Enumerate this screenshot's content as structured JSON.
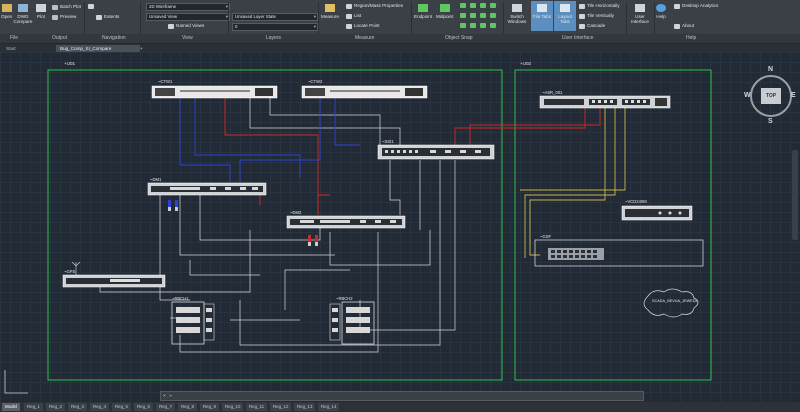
{
  "ribbon": {
    "open_label": "Open",
    "dwg_compare_label": "DWG Compare",
    "plot_label": "Plot",
    "batch_plot_label": "Batch Plot",
    "preview_label": "Preview",
    "extents_label": "Extents",
    "view_style_value": "2D Wireframe",
    "unsaved_view_value": "Unsaved View",
    "named_views_label": "Named Views",
    "layer_state_value": "Unsaved Layer State",
    "layer_value": "0",
    "measure_label": "Measure",
    "region_props_label": "Region/Mass Properties",
    "list_label": "List",
    "locate_point_label": "Locate Point",
    "endpoint_label": "Endpoint",
    "midpoint_label": "Midpoint",
    "switch_windows_label": "Switch Windows",
    "file_tabs_label": "File Tabs",
    "layout_tabs_label": "Layout Tabs",
    "tile_horiz_label": "Tile Horizontally",
    "tile_vert_label": "Tile Vertically",
    "cascade_label": "Cascade",
    "user_interface_label": "User Interface",
    "help_label": "Help",
    "desktop_analytics_label": "Desktop Analytics",
    "about_label": "About"
  },
  "panels": {
    "file": "File",
    "output": "Output",
    "navigation": "Navigation",
    "view": "View",
    "layers": "Layers",
    "measure": "Measure",
    "object_snap": "Object Snap",
    "user_interface": "User Interface",
    "help": "Help"
  },
  "doc_tabs": {
    "start": "Start",
    "file": "Bug_Comp_SI_Compare"
  },
  "drawing": {
    "frame1_label": "+U01",
    "frame2_label": "+U02",
    "dev_ctw1": "~CTW1",
    "dev_ctw2": "~CTW2",
    "dev_ssi1": "~SSI1",
    "dev_dm1": "~DM1",
    "dev_dm2": "~DM2",
    "dev_gps": "~GPS",
    "dev_rbc_a": "~RBCH1",
    "dev_rbc_b": "~RBCH2",
    "dev_asr": "~ASR_001",
    "dev_vcd": "~VCD240M",
    "dev_gsf": "~GSF",
    "cloud_text": "SCADA_BEVUA_JEWEDA"
  },
  "viewcube": {
    "top": "TOP",
    "n": "N",
    "s": "S",
    "e": "E",
    "w": "W"
  },
  "command_line": {
    "value": "»"
  },
  "layout_tabs": [
    "Model",
    "Reg_1",
    "Reg_2",
    "Reg_3",
    "Reg_4",
    "Reg_5",
    "Reg_6",
    "Reg_7",
    "Reg_8",
    "Reg_9",
    "Reg_10",
    "Reg_11",
    "Reg_12",
    "Reg_13",
    "Reg_14"
  ],
  "colors": {
    "frame": "#2cc14a",
    "wire_red": "#d02828",
    "wire_blue": "#3040d8",
    "wire_yellow": "#c9b64a",
    "wire_white": "#d8d8d8"
  }
}
